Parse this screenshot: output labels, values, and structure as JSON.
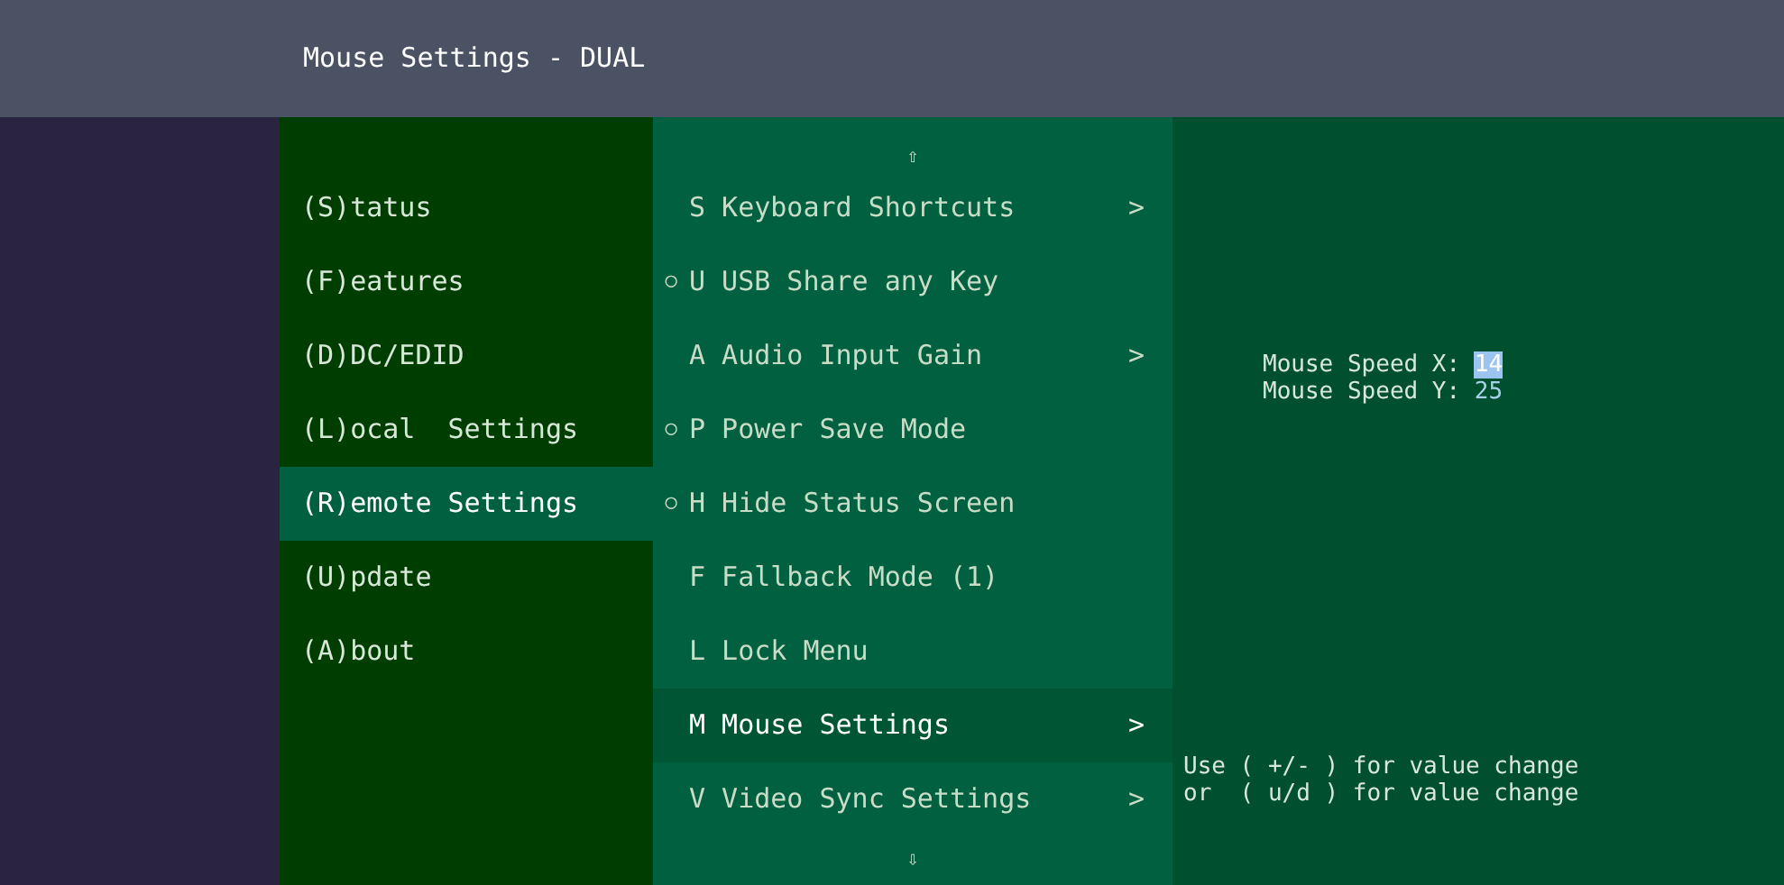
{
  "window": {
    "title": "Mouse Settings - DUAL"
  },
  "main_menu": [
    {
      "label": "(S)tatus",
      "selected": false
    },
    {
      "label": "(F)eatures",
      "selected": false
    },
    {
      "label": "(D)DC/EDID",
      "selected": false
    },
    {
      "label": "(L)ocal  Settings",
      "selected": false
    },
    {
      "label": "(R)emote Settings",
      "selected": true
    },
    {
      "label": "(U)pdate",
      "selected": false
    },
    {
      "label": "(A)bout",
      "selected": false
    }
  ],
  "submenu": {
    "scroll_up": "⇧",
    "scroll_down": "⇩",
    "items": [
      {
        "label": "S Keyboard Shortcuts",
        "arrow": ">",
        "selected": false
      },
      {
        "label": "U USB Share any Key",
        "marker": "○",
        "selected": false
      },
      {
        "label": "A Audio Input Gain",
        "arrow": ">",
        "selected": false
      },
      {
        "label": "P Power Save Mode",
        "marker": "○",
        "selected": false
      },
      {
        "label": "H Hide Status Screen",
        "marker": "○",
        "selected": false
      },
      {
        "label": "F Fallback Mode (1)",
        "selected": false
      },
      {
        "label": "L Lock Menu",
        "selected": false
      },
      {
        "label": "M Mouse Settings",
        "arrow": ">",
        "selected": true
      },
      {
        "label": "V Video Sync Settings",
        "arrow": ">",
        "selected": false
      }
    ]
  },
  "settings": [
    {
      "label": "Mouse Speed X:",
      "value": "14",
      "selected": true
    },
    {
      "label": "Mouse Speed Y:",
      "value": "25",
      "selected": false
    }
  ],
  "help": [
    "Use ( +/- ) for value change",
    "or  ( u/d ) for value change"
  ]
}
